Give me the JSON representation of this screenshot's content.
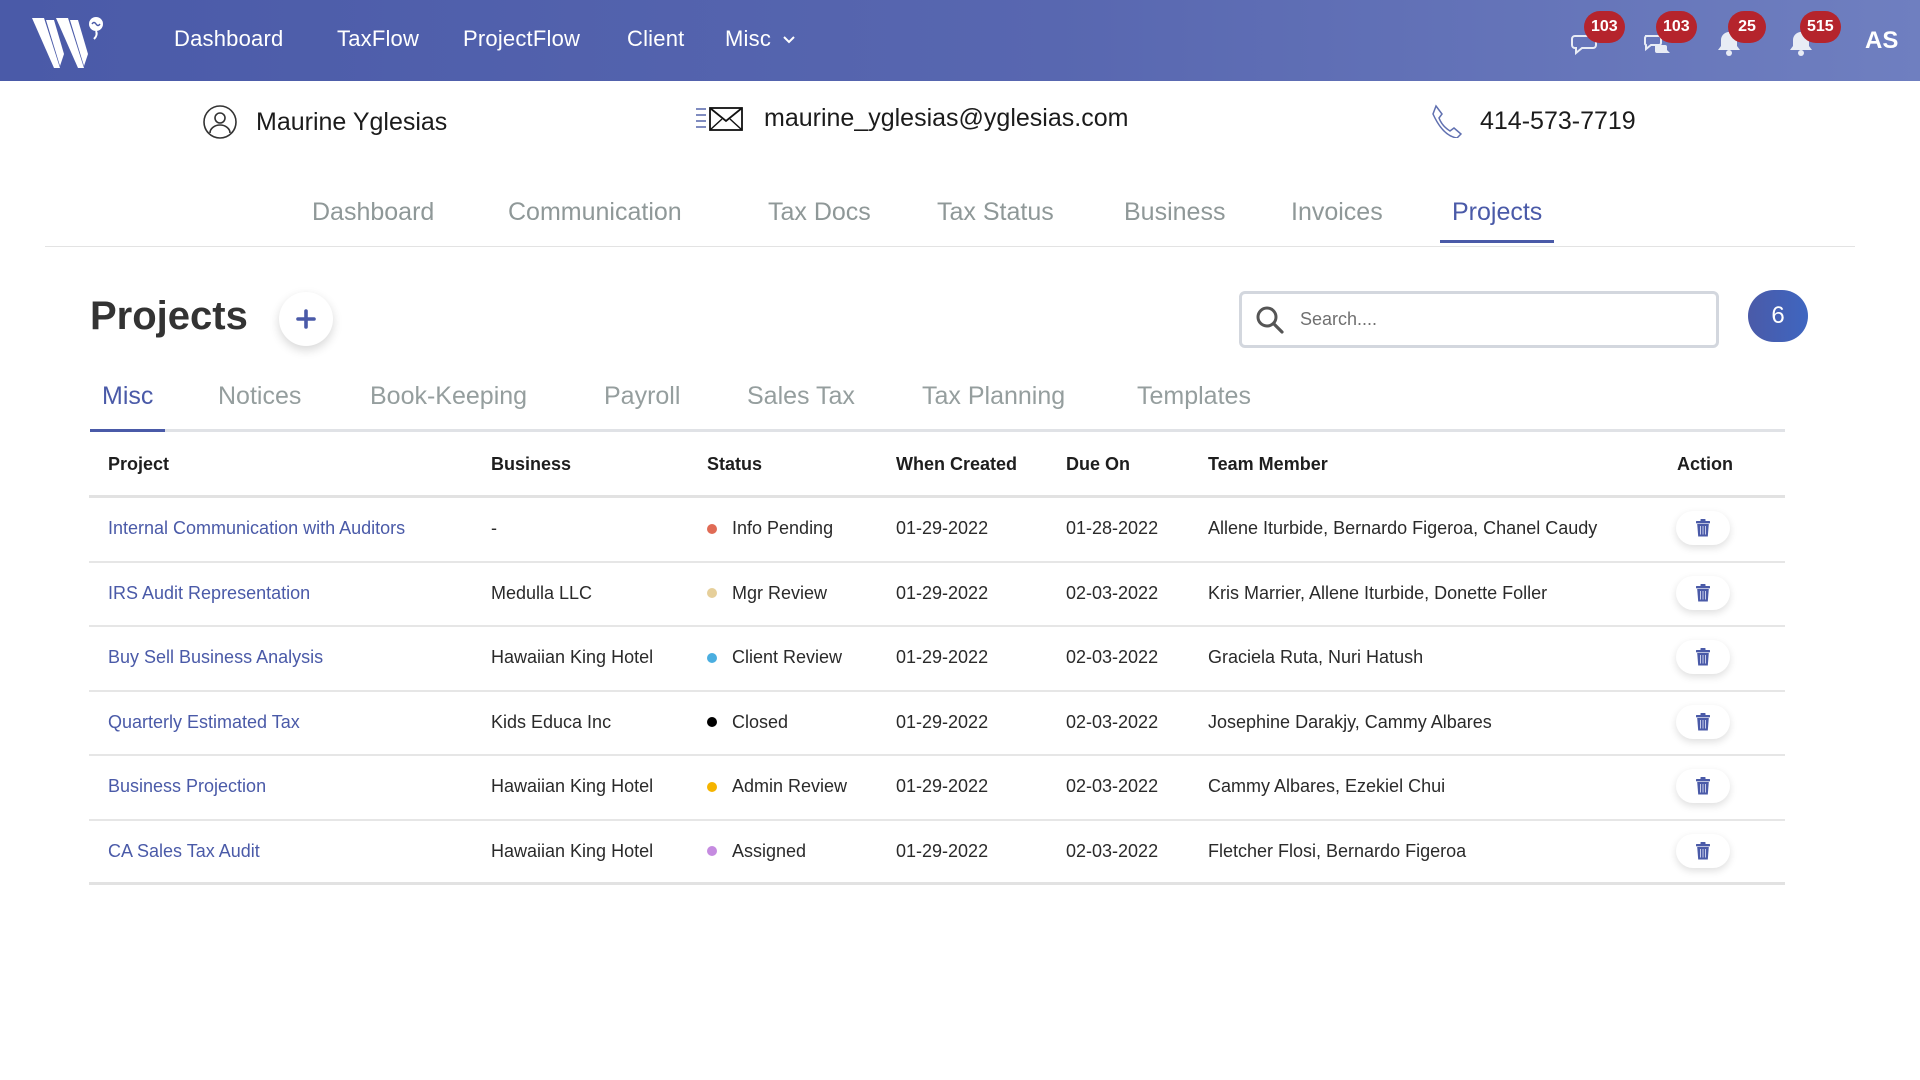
{
  "header": {
    "logo": "W logo",
    "nav": [
      {
        "label": "Dashboard"
      },
      {
        "label": "TaxFlow"
      },
      {
        "label": "ProjectFlow"
      },
      {
        "label": "Client"
      },
      {
        "label": "Misc",
        "icon": "chevron-down-icon"
      }
    ],
    "icons": [
      {
        "name": "chat-icon",
        "badge": "103"
      },
      {
        "name": "chats-icon",
        "badge": "103"
      },
      {
        "name": "bell-icon",
        "badge": "25"
      },
      {
        "name": "bell-icon",
        "badge": "515"
      }
    ],
    "user_initials": "AS",
    "colors": {
      "bar": "#4a5aa8",
      "badge": "#b5242c"
    }
  },
  "client": {
    "name": "Maurine Yglesias",
    "email": "maurine_yglesias@yglesias.com",
    "phone": "414-573-7719"
  },
  "section_tabs": [
    {
      "label": "Dashboard",
      "active": false
    },
    {
      "label": "Communication",
      "active": false
    },
    {
      "label": "Tax Docs",
      "active": false
    },
    {
      "label": "Tax Status",
      "active": false
    },
    {
      "label": "Business",
      "active": false
    },
    {
      "label": "Invoices",
      "active": false
    },
    {
      "label": "Projects",
      "active": true
    }
  ],
  "projects": {
    "title": "Projects",
    "add_label": "+",
    "search_placeholder": "Search....",
    "count": "6",
    "category_tabs": [
      {
        "label": "Misc",
        "active": true
      },
      {
        "label": "Notices",
        "active": false
      },
      {
        "label": "Book-Keeping",
        "active": false
      },
      {
        "label": "Payroll",
        "active": false
      },
      {
        "label": "Sales Tax",
        "active": false
      },
      {
        "label": "Tax Planning",
        "active": false
      },
      {
        "label": "Templates",
        "active": false
      }
    ],
    "columns": [
      "Project",
      "Business",
      "Status",
      "When Created",
      "Due On",
      "Team Member",
      "Action"
    ],
    "rows": [
      {
        "project": "Internal Communication with Auditors",
        "business": "-",
        "status": "Info Pending",
        "status_color": "#e06b55",
        "created": "01-29-2022",
        "due": "01-28-2022",
        "team": "Allene Iturbide, Bernardo Figeroa, Chanel Caudy"
      },
      {
        "project": "IRS Audit Representation",
        "business": "Medulla LLC",
        "status": "Mgr Review",
        "status_color": "#e6cf9a",
        "created": "01-29-2022",
        "due": "02-03-2022",
        "team": "Kris Marrier, Allene Iturbide, Donette Foller"
      },
      {
        "project": "Buy Sell Business Analysis",
        "business": "Hawaiian King Hotel",
        "status": "Client Review",
        "status_color": "#4aaee0",
        "created": "01-29-2022",
        "due": "02-03-2022",
        "team": "Graciela Ruta, Nuri Hatush"
      },
      {
        "project": "Quarterly Estimated Tax",
        "business": "Kids Educa Inc",
        "status": "Closed",
        "status_color": "#000000",
        "created": "01-29-2022",
        "due": "02-03-2022",
        "team": "Josephine Darakjy, Cammy Albares"
      },
      {
        "project": "Business Projection",
        "business": "Hawaiian King Hotel",
        "status": "Admin Review",
        "status_color": "#f5b400",
        "created": "01-29-2022",
        "due": "02-03-2022",
        "team": "Cammy Albares, Ezekiel Chui"
      },
      {
        "project": "CA Sales Tax Audit",
        "business": "Hawaiian King Hotel",
        "status": "Assigned",
        "status_color": "#c58be0",
        "created": "01-29-2022",
        "due": "02-03-2022",
        "team": "Fletcher Flosi, Bernardo Figeroa"
      }
    ]
  }
}
